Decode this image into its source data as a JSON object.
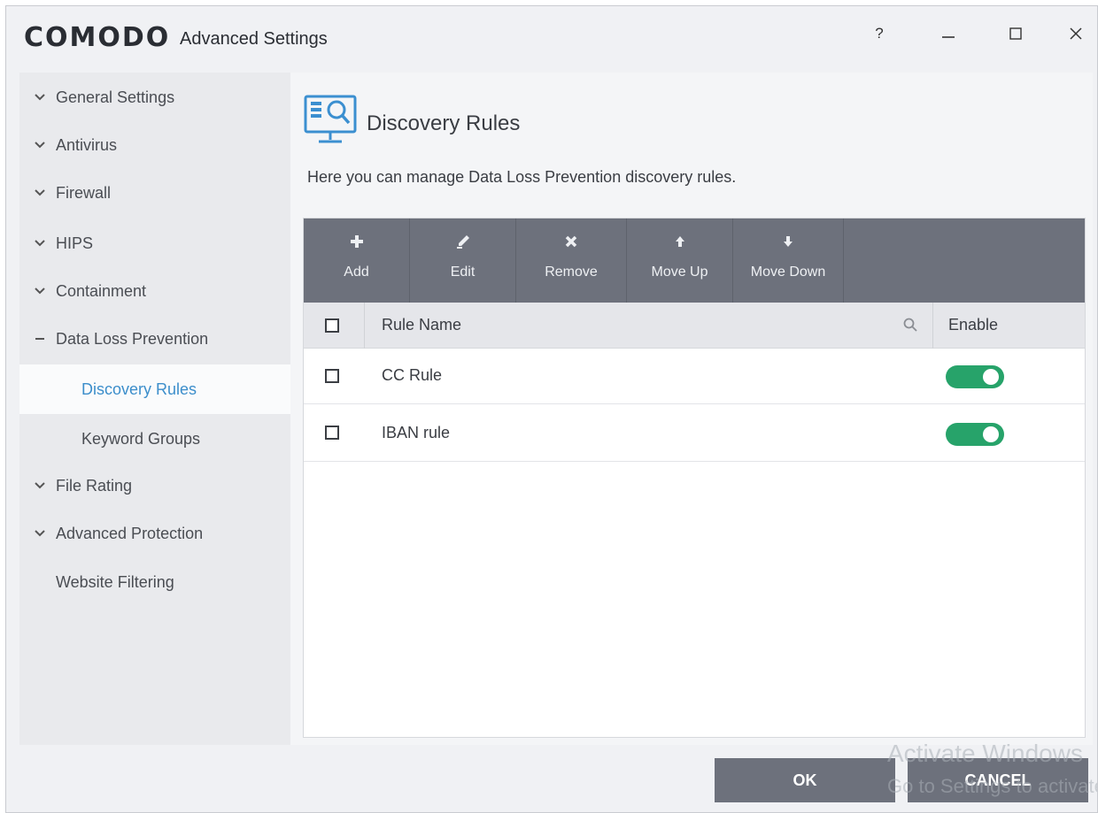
{
  "window": {
    "brand": "COMODO",
    "title": "Advanced Settings",
    "help_label": "?",
    "minimize_icon": "minimize-icon",
    "maximize_icon": "maximize-icon",
    "close_icon": "close-icon"
  },
  "sidebar": {
    "items": [
      {
        "label": "General Settings",
        "icon": "chevron-down-icon"
      },
      {
        "label": "Antivirus",
        "icon": "chevron-down-icon"
      },
      {
        "label": "Firewall",
        "icon": "chevron-down-icon"
      },
      {
        "label": "HIPS",
        "icon": "chevron-down-icon"
      },
      {
        "label": "Containment",
        "icon": "chevron-down-icon"
      },
      {
        "label": "Data Loss Prevention",
        "icon": "collapse-dash-icon"
      },
      {
        "label": "Discovery Rules",
        "active": true
      },
      {
        "label": "Keyword Groups"
      },
      {
        "label": "File Rating",
        "icon": "chevron-down-icon"
      },
      {
        "label": "Advanced Protection",
        "icon": "chevron-down-icon"
      },
      {
        "label": "Website Filtering"
      }
    ]
  },
  "main": {
    "icon": "monitor-search-icon",
    "title": "Discovery Rules",
    "description": "Here you can manage Data Loss Prevention discovery rules."
  },
  "toolbar": {
    "buttons": [
      {
        "label": "Add",
        "icon": "plus-icon"
      },
      {
        "label": "Edit",
        "icon": "pencil-icon"
      },
      {
        "label": "Remove",
        "icon": "x-icon"
      },
      {
        "label": "Move Up",
        "icon": "arrow-up-icon"
      },
      {
        "label": "Move Down",
        "icon": "arrow-down-icon"
      }
    ]
  },
  "table": {
    "columns": {
      "name": "Rule Name",
      "enable": "Enable"
    },
    "rows": [
      {
        "name": "CC Rule",
        "checked": false,
        "enabled": true
      },
      {
        "name": "IBAN rule",
        "checked": false,
        "enabled": true
      }
    ]
  },
  "footer": {
    "ok_label": "OK",
    "cancel_label": "CANCEL",
    "watermark_line1": "Activate Windows",
    "watermark_line2": "Go to Settings to activate Windows."
  },
  "colors": {
    "toolbar": "#6d717c",
    "toggle_on": "#27a36a",
    "active_nav_text": "#3c8ecb"
  }
}
